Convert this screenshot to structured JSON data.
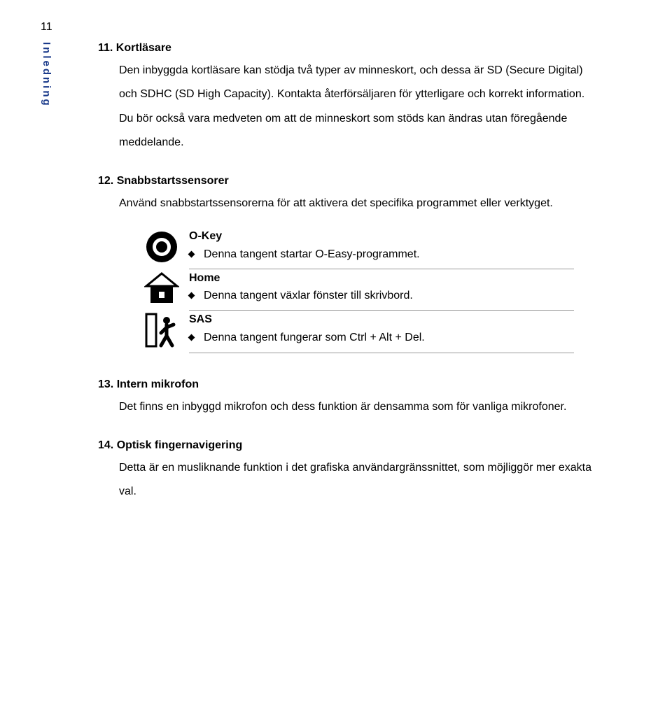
{
  "page_number": "11",
  "side_tab": "Inledning",
  "sections": {
    "s11": {
      "heading": "11. Kortläsare",
      "body": "Den inbyggda kortläsare kan stödja två typer av minneskort, och dessa är SD (Secure Digital) och SDHC (SD High Capacity).    Kontakta återförsäljaren för ytterligare och korrekt information.    Du bör också vara medveten om att de minneskort som stöds kan ändras utan föregående meddelande."
    },
    "s12": {
      "heading": "12. Snabbstartssensorer",
      "body": "Använd snabbstartssensorerna för att aktivera det specifika programmet eller verktyget.",
      "keys": {
        "okey": {
          "label": "O-Key",
          "desc": "Denna tangent startar O-Easy-programmet."
        },
        "home": {
          "label": "Home",
          "desc": "Denna tangent växlar fönster till skrivbord."
        },
        "sas": {
          "label": "SAS",
          "desc": "Denna tangent fungerar som Ctrl + Alt + Del."
        }
      }
    },
    "s13": {
      "heading": "13. Intern mikrofon",
      "body": "Det finns en inbyggd mikrofon och dess funktion är densamma som för vanliga mikrofoner."
    },
    "s14": {
      "heading": "14. Optisk fingernavigering",
      "body": "Detta är en musliknande funktion i det grafiska användargränssnittet, som möjliggör mer exakta val."
    }
  }
}
